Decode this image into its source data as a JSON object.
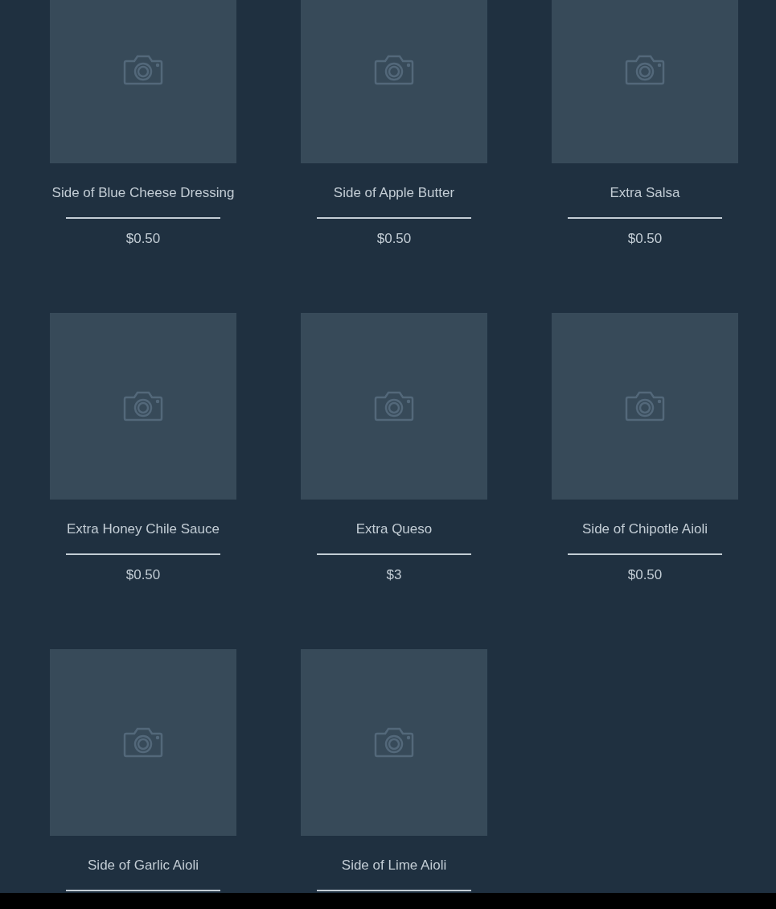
{
  "products": [
    {
      "name": "Side of Blue Cheese Dressing",
      "price": "$0.50"
    },
    {
      "name": "Side of Apple Butter",
      "price": "$0.50"
    },
    {
      "name": "Extra Salsa",
      "price": "$0.50"
    },
    {
      "name": "Extra Honey Chile Sauce",
      "price": "$0.50"
    },
    {
      "name": "Extra Queso",
      "price": "$3"
    },
    {
      "name": "Side of Chipotle Aioli",
      "price": "$0.50"
    },
    {
      "name": "Side of Garlic Aioli"
    },
    {
      "name": "Side of Lime Aioli"
    }
  ]
}
